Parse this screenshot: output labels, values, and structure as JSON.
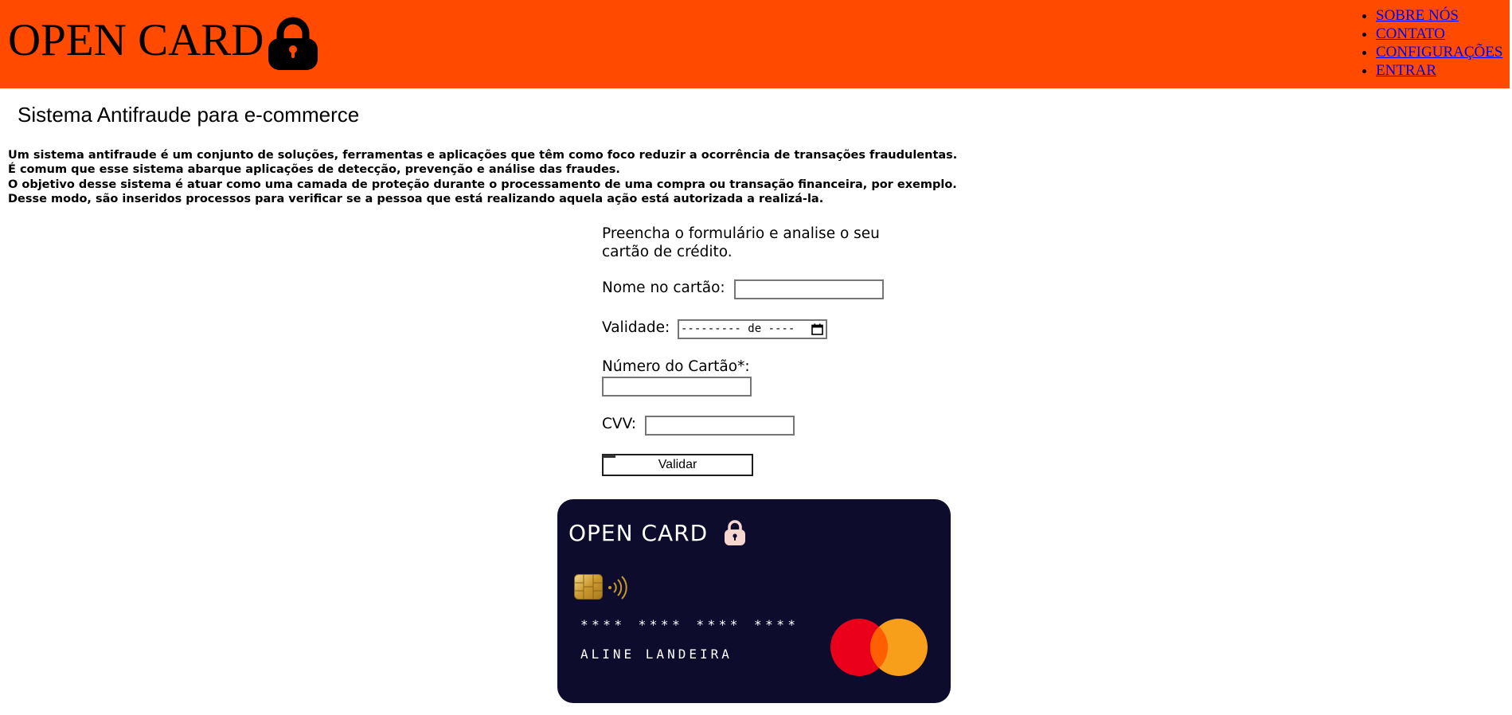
{
  "header": {
    "brand": "OPEN CARD",
    "brand_icon": "lock-icon",
    "background_color": "#ff4a00",
    "nav": [
      {
        "label": "SOBRE NÓS"
      },
      {
        "label": "CONTATO"
      },
      {
        "label": "CONFIGURAÇÕES"
      },
      {
        "label": "ENTRAR"
      }
    ]
  },
  "content": {
    "heading": "Sistema Antifraude para e-commerce",
    "intro_lines": [
      "Um sistema antifraude é um conjunto de soluções, ferramentas e aplicações que têm como foco reduzir a ocorrência de transações fraudulentas.",
      "É comum que esse sistema abarque aplicações de detecção, prevenção e análise das fraudes.",
      "O objetivo desse sistema é atuar como uma camada de proteção durante o processamento de uma compra ou transação financeira, por exemplo.",
      "Desse modo, são inseridos processos para verificar se a pessoa que está realizando aquela ação está autorizada a realizá-la."
    ]
  },
  "form": {
    "intro": "Preencha o formulário e analise o seu cartão de crédito.",
    "name_label": "Nome no cartão:",
    "name_value": "",
    "validity_label": "Validade:",
    "validity_placeholder": "--------- de ----",
    "number_label": "Número do Cartão*:",
    "number_value": "",
    "cvv_label": "CVV:",
    "cvv_value": "",
    "submit_label": "Validar"
  },
  "card": {
    "brand": "OPEN CARD",
    "brand_icon": "lock-icon",
    "chip_icon": "chip-icon",
    "contactless_icon": "contactless-icon",
    "number": "**** **** **** ****",
    "holder": "ALINE LANDEIRA",
    "network_logo": "mastercard-logo",
    "background_color": "#0e0c2c",
    "logo_colors": [
      "#eb001b",
      "#f79e1b",
      "#ff5f00"
    ]
  }
}
